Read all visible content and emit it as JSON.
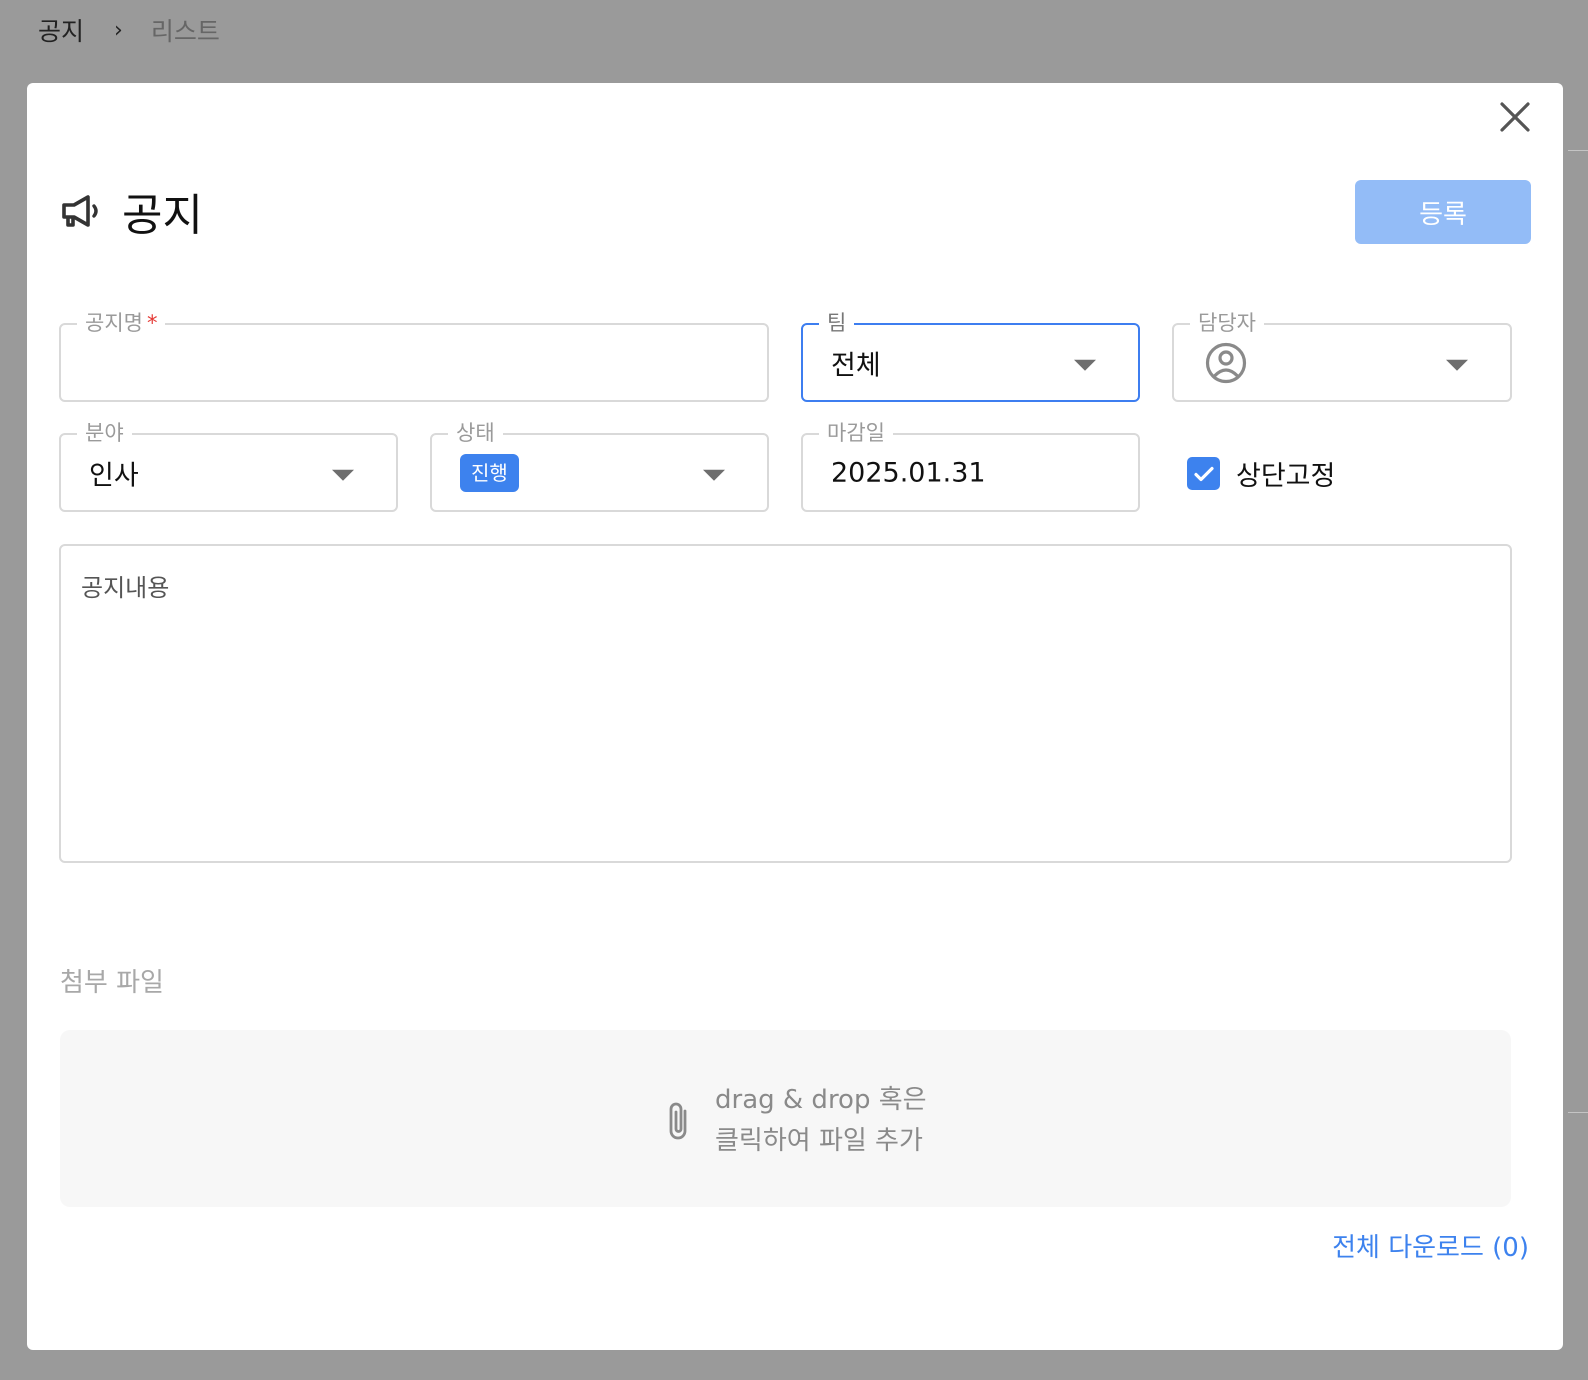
{
  "breadcrumb": {
    "root": "공지",
    "separator": "›",
    "current": "리스트"
  },
  "modal": {
    "title": "공지",
    "submit_label": "등록",
    "fields": {
      "notice_name": {
        "label": "공지명",
        "required_mark": "*",
        "value": ""
      },
      "team": {
        "label": "팀",
        "value": "전체"
      },
      "assignee": {
        "label": "담당자",
        "value": ""
      },
      "category": {
        "label": "분야",
        "value": "인사"
      },
      "status": {
        "label": "상태",
        "value": "진행"
      },
      "deadline": {
        "label": "마감일",
        "value": "2025.01.31"
      }
    },
    "pin_top": {
      "label": "상단고정",
      "checked": true
    },
    "content": {
      "placeholder": "공지내용",
      "value": ""
    },
    "attachments": {
      "title": "첨부 파일",
      "dropzone_line1": "drag & drop 혹은",
      "dropzone_line2": "클릭하여 파일 추가",
      "download_all": "전체 다운로드 (0)"
    }
  },
  "colors": {
    "accent": "#3d82ee",
    "submit_disabled": "#93bcf7",
    "focus_border": "#3d7ef0",
    "required": "#e53935"
  },
  "icons": [
    "close-icon",
    "megaphone-icon",
    "chevron-down-icon",
    "person-circle-icon",
    "checkmark-icon",
    "paperclip-icon"
  ]
}
